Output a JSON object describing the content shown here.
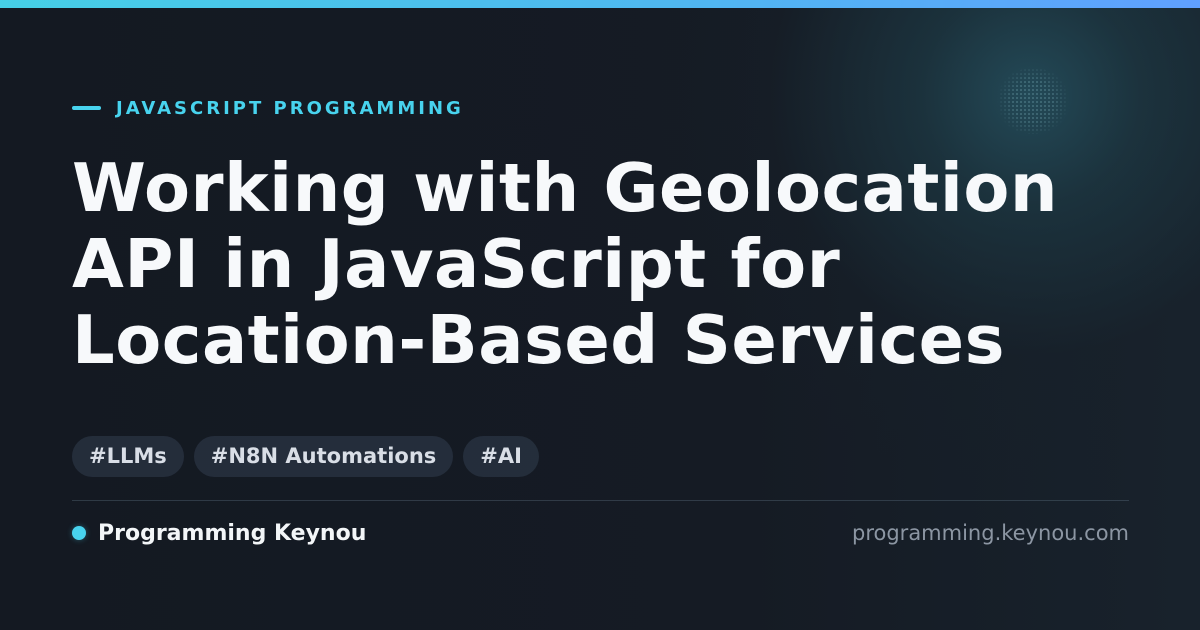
{
  "theme": {
    "background": "#141922",
    "accent": "#48d3ee",
    "title_color": "#f7f9fb",
    "muted_text": "#8c96a3",
    "tag_background": "#2a3543"
  },
  "header": {
    "category": "JAVASCRIPT PROGRAMMING",
    "title_lines": [
      "Working with Geolocation",
      "API in JavaScript for",
      "Location-Based Services"
    ]
  },
  "tags": [
    "#LLMs",
    "#N8N Automations",
    "#AI"
  ],
  "footer": {
    "brand": "Programming Keynou",
    "domain": "programming.keynou.com"
  },
  "icons": {
    "category_marker": "accent-line-icon",
    "brand_marker": "status-dot-icon"
  }
}
